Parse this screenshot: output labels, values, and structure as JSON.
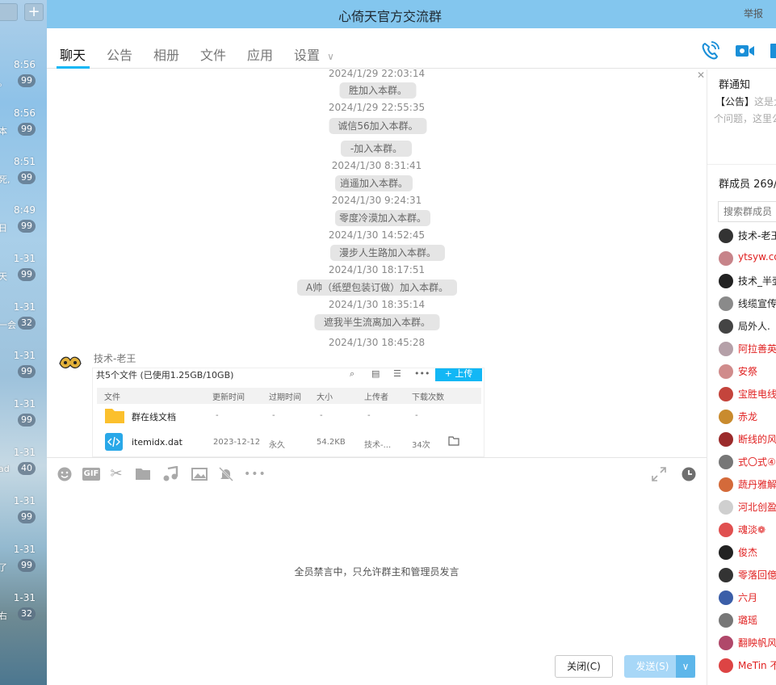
{
  "window": {
    "title": "心倚天官方交流群",
    "report_label": "举报"
  },
  "tabs": [
    {
      "label": "聊天",
      "active": true
    },
    {
      "label": "公告"
    },
    {
      "label": "相册"
    },
    {
      "label": "文件"
    },
    {
      "label": "应用"
    },
    {
      "label": "设置"
    }
  ],
  "conversations": [
    {
      "time": "8:56",
      "snippet": "。",
      "badge": "99"
    },
    {
      "time": "8:56",
      "snippet": "本",
      "badge": "99"
    },
    {
      "time": "8:51",
      "snippet": "死,",
      "badge": "99"
    },
    {
      "time": "8:49",
      "snippet": "日",
      "badge": "99"
    },
    {
      "time": "1-31",
      "snippet": "天",
      "badge": "99"
    },
    {
      "time": "1-31",
      "snippet": "一会",
      "badge": "32"
    },
    {
      "time": "1-31",
      "snippet": "",
      "badge": "99"
    },
    {
      "time": "1-31",
      "snippet": "",
      "badge": "99"
    },
    {
      "time": "1-31",
      "snippet": "ad",
      "badge": "40"
    },
    {
      "time": "1-31",
      "snippet": "",
      "badge": "99"
    },
    {
      "time": "1-31",
      "snippet": "了",
      "badge": "99"
    },
    {
      "time": "1-31",
      "snippet": "右",
      "badge": "32"
    }
  ],
  "chat": {
    "messages": [
      {
        "type": "timestamp",
        "text": "2024/1/29 22:03:14"
      },
      {
        "type": "system",
        "text": "胜加入本群。"
      },
      {
        "type": "timestamp",
        "text": "2024/1/29 22:55:35"
      },
      {
        "type": "system",
        "text": "诚信56加入本群。"
      },
      {
        "type": "system",
        "text": "-加入本群。"
      },
      {
        "type": "timestamp",
        "text": "2024/1/30 8:31:41"
      },
      {
        "type": "system",
        "text": "逍遥加入本群。"
      },
      {
        "type": "timestamp",
        "text": "2024/1/30 9:24:31"
      },
      {
        "type": "system",
        "text": "零度冷漠加入本群。"
      },
      {
        "type": "timestamp",
        "text": "2024/1/30 14:52:45"
      },
      {
        "type": "system",
        "text": "漫步人生路加入本群。"
      },
      {
        "type": "timestamp",
        "text": "2024/1/30 18:17:51"
      },
      {
        "type": "system",
        "text": "A帅（纸塑包装订做）加入本群。"
      },
      {
        "type": "timestamp",
        "text": "2024/1/30 18:35:14"
      },
      {
        "type": "system",
        "text": "遮我半生流离加入本群。"
      },
      {
        "type": "timestamp",
        "text": "2024/1/30 18:45:28"
      }
    ],
    "sender_name": "技术-老王",
    "file_screenshot": {
      "summary": "共5个文件 (已使用1.25GB/10GB)",
      "upload_label": "+ 上传",
      "headers": [
        "文件",
        "更新时间",
        "过期时间",
        "大小",
        "上传者",
        "下载次数"
      ],
      "rows": [
        {
          "name": "群在线文档",
          "updated": "-",
          "expires": "-",
          "size": "-",
          "uploader": "-",
          "downloads": "-"
        },
        {
          "name": "itemidx.dat",
          "updated": "2023-12-12",
          "expires": "永久",
          "size": "54.2KB",
          "uploader": "技术-...",
          "downloads": "34次"
        }
      ]
    }
  },
  "composer": {
    "muted_notice": "全员禁言中，只允许群主和管理员发言",
    "close_label": "关闭(C)",
    "send_label": "发送(S)"
  },
  "right_panel": {
    "notice_title": "群通知",
    "notice_tag": "【公告】",
    "notice_preview": "这是大",
    "notice_line2": "个问题，这里公",
    "members_title": "群成员 269/",
    "search_placeholder": "搜索群成员",
    "members": [
      {
        "name": "技术-老王",
        "color": "#222222"
      },
      {
        "name": "ytsyw.co",
        "color": "#e02020"
      },
      {
        "name": "技术_半壶",
        "color": "#222222"
      },
      {
        "name": "线缆宣传",
        "color": "#222222"
      },
      {
        "name": "局外人.",
        "color": "#222222"
      },
      {
        "name": "阿拉善英",
        "color": "#e02020"
      },
      {
        "name": "安祭",
        "color": "#e02020"
      },
      {
        "name": "宝胜电线",
        "color": "#e02020"
      },
      {
        "name": "赤龙",
        "color": "#e02020"
      },
      {
        "name": "断线的风",
        "color": "#e02020"
      },
      {
        "name": "式〇式④",
        "color": "#e02020"
      },
      {
        "name": "蔬丹雅解",
        "color": "#e02020"
      },
      {
        "name": "河北创盈",
        "color": "#e02020"
      },
      {
        "name": "魂淡❁",
        "color": "#e02020"
      },
      {
        "name": "俊杰",
        "color": "#e02020"
      },
      {
        "name": "零落回億",
        "color": "#e02020"
      },
      {
        "name": "六月",
        "color": "#e02020"
      },
      {
        "name": "璐瑶",
        "color": "#e02020"
      },
      {
        "name": "翻眏帆风",
        "color": "#e02020"
      },
      {
        "name": "MeTin 不",
        "color": "#e02020"
      }
    ]
  }
}
